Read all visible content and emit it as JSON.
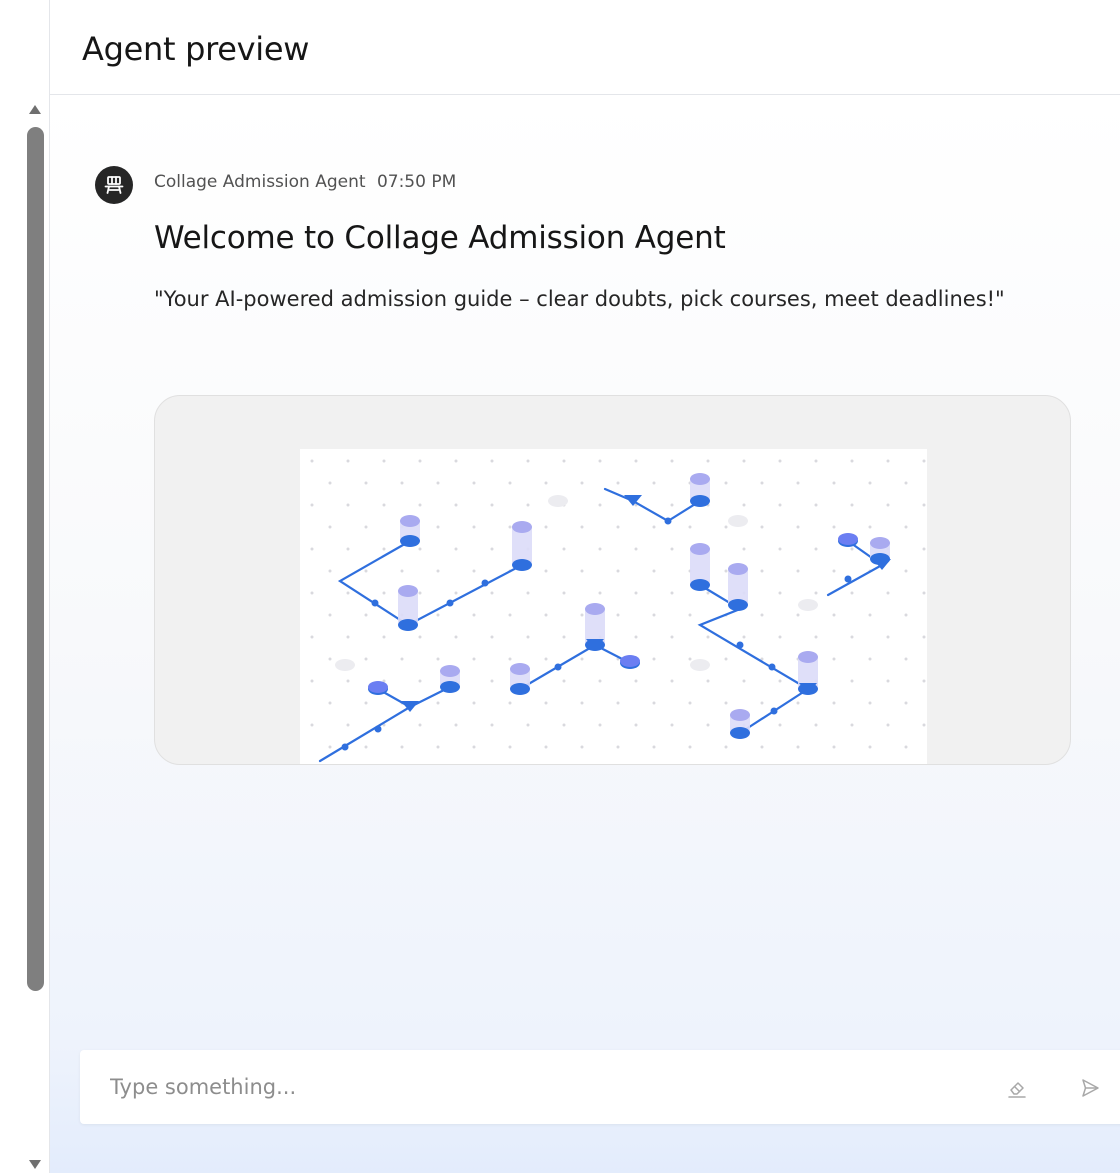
{
  "header": {
    "title": "Agent preview"
  },
  "message": {
    "agent_name": "Collage Admission Agent",
    "time": "07:50 PM",
    "title": "Welcome to Collage Admission Agent",
    "description": "\"Your AI-powered admission guide – clear doubts, pick courses, meet deadlines!\"",
    "avatar_icon": "robot-icon"
  },
  "input": {
    "placeholder": "Type something...",
    "value": ""
  },
  "icons": {
    "clear": "eraser-icon",
    "send": "send-icon"
  },
  "colors": {
    "accent": "#2f6fde",
    "accent_light": "#a9aaf0",
    "avatar_bg": "#262626",
    "scrollbar_thumb": "#7f7f7f"
  }
}
